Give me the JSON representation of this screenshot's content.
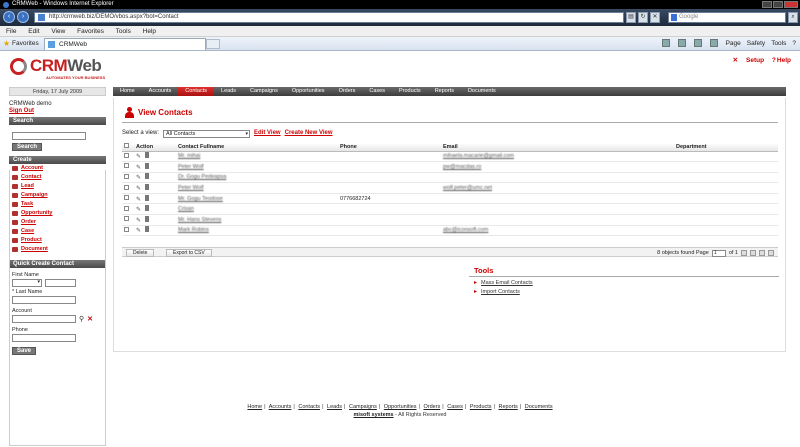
{
  "browser": {
    "window_title": "CRMWeb - Windows Internet Explorer",
    "url": "http://crmweb.biz/DEMO/vbos.aspx?bot=Contact",
    "search_placeholder": "Google",
    "menu": [
      "File",
      "Edit",
      "View",
      "Favorites",
      "Tools",
      "Help"
    ],
    "favorites_label": "Favorites",
    "tab_title": "CRMWeb",
    "commands": [
      "Page",
      "Safety",
      "Tools"
    ]
  },
  "app": {
    "logo_text_red": "CRM",
    "logo_text_gray": "Web",
    "logo_tagline": "AUTOMATES YOUR BUSINESS",
    "setup_label": "Setup",
    "help_label": "Help",
    "date": "Friday, 17 July 2009",
    "nav": [
      "Home",
      "Accounts",
      "Contacts",
      "Leads",
      "Campaigns",
      "Opportunities",
      "Orders",
      "Cases",
      "Products",
      "Reports",
      "Documents"
    ],
    "nav_active": "Contacts"
  },
  "sidebar": {
    "user": "CRMWeb demo",
    "signout": "Sign Out",
    "search_header": "Search",
    "search_button": "Search",
    "create_header": "Create",
    "create_items": [
      "Account",
      "Contact",
      "Lead",
      "Campaign",
      "Task",
      "Opportunity",
      "Order",
      "Case",
      "Product",
      "Document"
    ],
    "quick_header": "Quick Create Contact",
    "first_name_label": "First Name",
    "last_name_label": "* Last Name",
    "account_label": "Account",
    "phone_label": "Phone",
    "save_button": "Save"
  },
  "main": {
    "title": "View Contacts",
    "select_view_label": "Select a view:",
    "selected_view": "All Contacts",
    "edit_view": "Edit View",
    "create_view": "Create New View",
    "columns": [
      "Action",
      "Contact Fullname",
      "Phone",
      "Email",
      "Department"
    ],
    "rows": [
      {
        "name": "Mr. mihai",
        "phone": "",
        "email": "mihaela.macarie@gmail.com"
      },
      {
        "name": "Peter Wolf",
        "phone": "",
        "email": "pw@macdas.ro"
      },
      {
        "name": "Dr. Gogu Pedeapsa",
        "phone": "",
        "email": ""
      },
      {
        "name": "Peter Wolf",
        "phone": "",
        "email": "wolf.peter@umc.net"
      },
      {
        "name": "Mr. Gogu Teodose",
        "phone": "0776682724",
        "email": ""
      },
      {
        "name": "Crisan",
        "phone": "",
        "email": ""
      },
      {
        "name": "Mr. Hans Stevens",
        "phone": "",
        "email": ""
      },
      {
        "name": "Mark Robins",
        "phone": "",
        "email": "abc@iconsoft.com"
      }
    ],
    "delete_button": "Delete",
    "export_button": "Export to CSV",
    "pager_text": "8 objects found Page",
    "pager_page": "1",
    "pager_of": "of 1"
  },
  "tools": {
    "title": "Tools",
    "items": [
      "Mass Email Contacts",
      "Import Contacts"
    ]
  },
  "footer": {
    "links": [
      "Home",
      "Accounts",
      "Contacts",
      "Leads",
      "Campaigns",
      "Opportunities",
      "Orders",
      "Cases",
      "Products",
      "Reports",
      "Documents"
    ],
    "company": "misoft systems",
    "rights": " - All Rights Reserved"
  }
}
